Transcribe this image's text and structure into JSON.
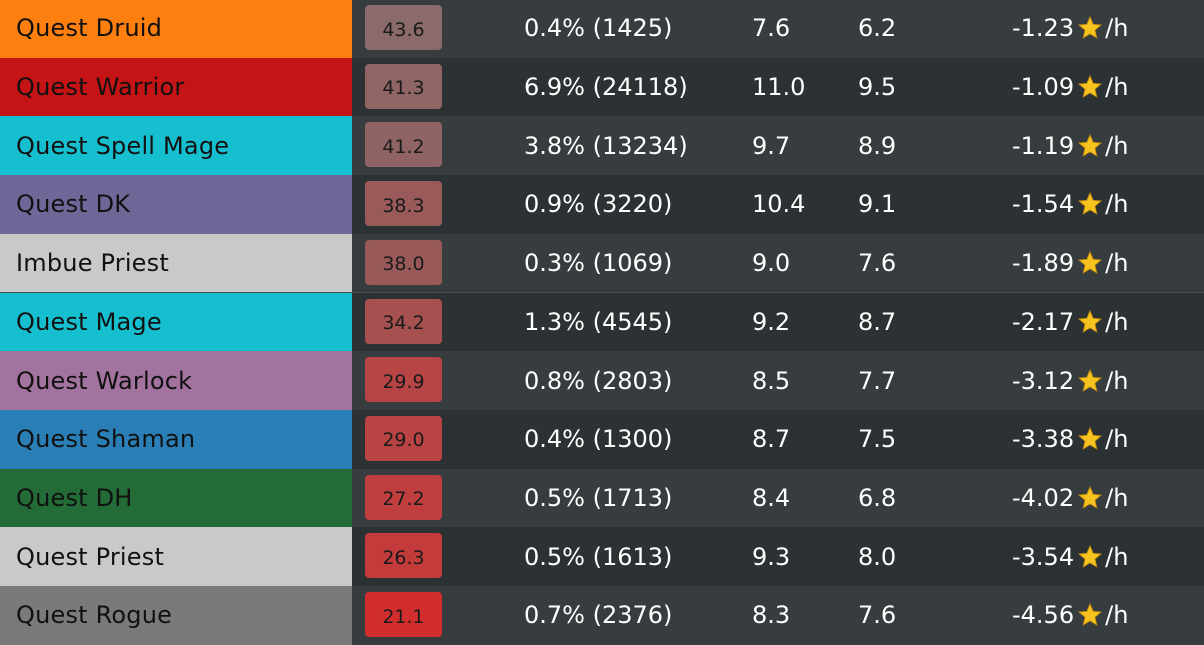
{
  "rows": [
    {
      "deck": "Quest Druid",
      "deck_color": "#fd7f0f",
      "text_color": "#111111",
      "winrate": "43.6",
      "wr_bg": "#8a6a6a",
      "popularity": "0.4% (1425)",
      "duration": "7.6",
      "turns": "6.2",
      "climb": "-1.23",
      "climb_unit": "/h"
    },
    {
      "deck": "Quest Warrior",
      "deck_color": "#c51415",
      "text_color": "#111111",
      "winrate": "41.3",
      "wr_bg": "#8f6565",
      "popularity": "6.9% (24118)",
      "duration": "11.0",
      "turns": "9.5",
      "climb": "-1.09",
      "climb_unit": "/h"
    },
    {
      "deck": "Quest Spell Mage",
      "deck_color": "#16bfd0",
      "text_color": "#111111",
      "winrate": "41.2",
      "wr_bg": "#906464",
      "popularity": "3.8% (13234)",
      "duration": "9.7",
      "turns": "8.9",
      "climb": "-1.19",
      "climb_unit": "/h"
    },
    {
      "deck": "Quest DK",
      "deck_color": "#6e6898",
      "text_color": "#111111",
      "winrate": "38.3",
      "wr_bg": "#9a5a5a",
      "popularity": "0.9% (3220)",
      "duration": "10.4",
      "turns": "9.1",
      "climb": "-1.54",
      "climb_unit": "/h"
    },
    {
      "deck": "Imbue Priest",
      "deck_color": "#c9c9c9",
      "text_color": "#111111",
      "winrate": "38.0",
      "wr_bg": "#9a5959",
      "popularity": "0.3% (1069)",
      "duration": "9.0",
      "turns": "7.6",
      "climb": "-1.89",
      "climb_unit": "/h"
    },
    {
      "deck": "Quest Mage",
      "deck_color": "#16bfd0",
      "text_color": "#111111",
      "winrate": "34.2",
      "wr_bg": "#a65050",
      "popularity": "1.3% (4545)",
      "duration": "9.2",
      "turns": "8.7",
      "climb": "-2.17",
      "climb_unit": "/h"
    },
    {
      "deck": "Quest Warlock",
      "deck_color": "#a1739e",
      "text_color": "#111111",
      "winrate": "29.9",
      "wr_bg": "#b74545",
      "popularity": "0.8% (2803)",
      "duration": "8.5",
      "turns": "7.7",
      "climb": "-3.12",
      "climb_unit": "/h"
    },
    {
      "deck": "Quest Shaman",
      "deck_color": "#2a7fb6",
      "text_color": "#111111",
      "winrate": "29.0",
      "wr_bg": "#ba4343",
      "popularity": "0.4% (1300)",
      "duration": "8.7",
      "turns": "7.5",
      "climb": "-3.38",
      "climb_unit": "/h"
    },
    {
      "deck": "Quest DH",
      "deck_color": "#236b37",
      "text_color": "#111111",
      "winrate": "27.2",
      "wr_bg": "#c03e3e",
      "popularity": "0.5% (1713)",
      "duration": "8.4",
      "turns": "6.8",
      "climb": "-4.02",
      "climb_unit": "/h"
    },
    {
      "deck": "Quest Priest",
      "deck_color": "#c9c9c9",
      "text_color": "#111111",
      "winrate": "26.3",
      "wr_bg": "#c43b3b",
      "popularity": "0.5% (1613)",
      "duration": "9.3",
      "turns": "8.0",
      "climb": "-3.54",
      "climb_unit": "/h"
    },
    {
      "deck": "Quest Rogue",
      "deck_color": "#7a7a7a",
      "text_color": "#111111",
      "winrate": "21.1",
      "wr_bg": "#d32e2e",
      "popularity": "0.7% (2376)",
      "duration": "8.3",
      "turns": "7.6",
      "climb": "-4.56",
      "climb_unit": "/h"
    }
  ]
}
